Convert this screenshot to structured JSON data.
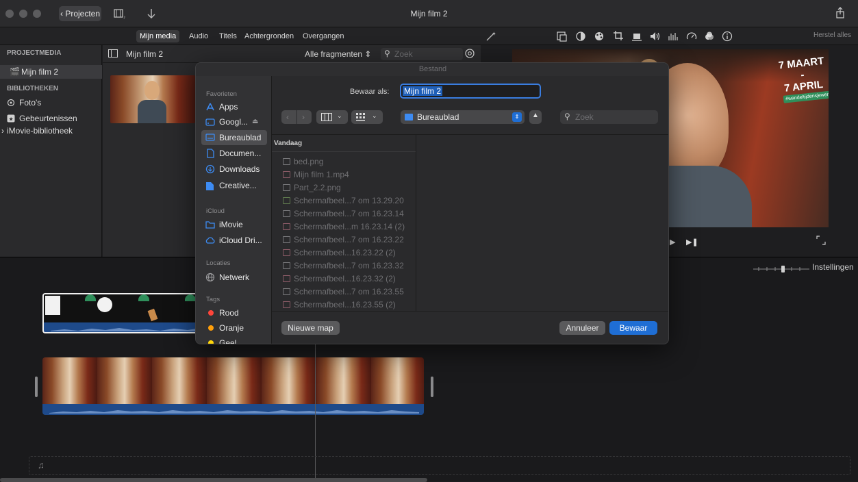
{
  "window": {
    "title": "Mijn film 2",
    "back_label": "Projecten"
  },
  "tabs": [
    {
      "label": "Mijn media"
    },
    {
      "label": "Audio"
    },
    {
      "label": "Titels"
    },
    {
      "label": "Achtergronden"
    },
    {
      "label": "Overgangen"
    }
  ],
  "toolbar": {
    "reset_label": "Herstel alles"
  },
  "library": {
    "project_media_header": "PROJECTMEDIA",
    "project_item": "Mijn film 2",
    "libraries_header": "BIBLIOTHEKEN",
    "items": [
      "Foto's",
      "Gebeurtenissen",
      "iMovie-bibliotheek"
    ]
  },
  "browser": {
    "title": "Mijn film 2",
    "filter": "Alle fragmenten",
    "search_placeholder": "Zoek"
  },
  "viewer": {
    "overlay_line1": "7 MAART -",
    "overlay_line2": "7 APRIL",
    "hashtag": "#wandeltijdensjewerk",
    "settings_label": "Instellingen"
  },
  "dialog": {
    "title": "Bestand",
    "save_as_label": "Bewaar als:",
    "filename": "Mijn film 2",
    "location": "Bureaublad",
    "search_placeholder": "Zoek",
    "favorites_header": "Favorieten",
    "favorites": [
      "Apps",
      "Googl...",
      "Bureaublad",
      "Documen...",
      "Downloads",
      "Creative..."
    ],
    "icloud_header": "iCloud",
    "icloud": [
      "iMovie",
      "iCloud Dri..."
    ],
    "locations_header": "Locaties",
    "locations": [
      "Netwerk"
    ],
    "tags_header": "Tags",
    "tags": [
      {
        "label": "Rood",
        "color": "#ff453a"
      },
      {
        "label": "Oranje",
        "color": "#ff9f0a"
      },
      {
        "label": "Geel",
        "color": "#ffd60a"
      }
    ],
    "column_header": "Vandaag",
    "files": [
      "bed.png",
      "Mijn film 1.mp4",
      "Part_2.2.png",
      "Schermafbeel...7 om 13.29.20",
      "Schermafbeel...7 om 16.23.14",
      "Schermafbeel...m 16.23.14 (2)",
      "Schermafbeel...7 om 16.23.22",
      "Schermafbeel...16.23.22 (2)",
      "Schermafbeel...7 om 16.23.32",
      "Schermafbeel...16.23.32 (2)",
      "Schermafbeel...7 om 16.23.55",
      "Schermafbeel...16.23.55 (2)"
    ],
    "new_folder_label": "Nieuwe map",
    "cancel_label": "Annuleer",
    "save_label": "Bewaar"
  },
  "colors": {
    "accent": "#1f6ed4",
    "overlay_text": "#ffffff",
    "overlay_green": "#2f8f5b"
  }
}
